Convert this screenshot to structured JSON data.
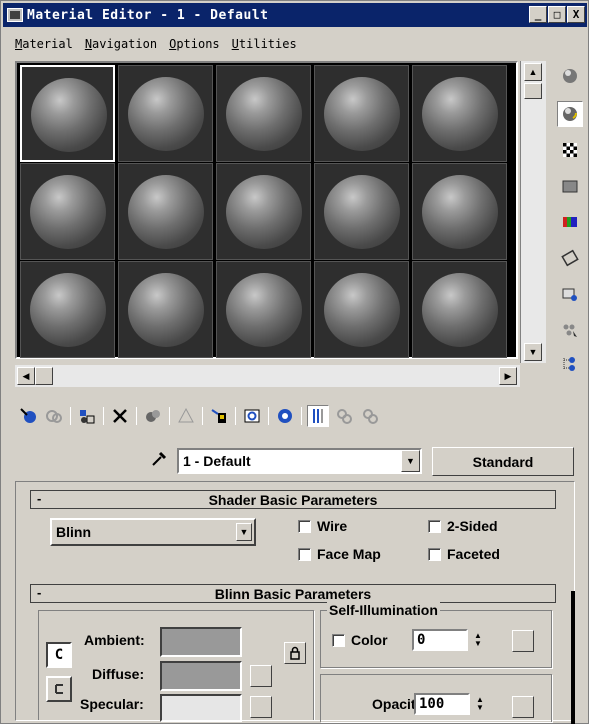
{
  "window": {
    "title": "Material Editor - 1 - Default",
    "buttons": [
      "_",
      "□",
      "X"
    ]
  },
  "menu": [
    {
      "label": "Material",
      "underline": "M"
    },
    {
      "label": "Navigation",
      "underline": "N"
    },
    {
      "label": "Options",
      "underline": "O"
    },
    {
      "label": "Utilities",
      "underline": "U"
    }
  ],
  "samples": {
    "rows": 3,
    "cols": 5,
    "selected_index": 0
  },
  "right_toolbar": [
    {
      "icon": "sample-type-sphere-icon"
    },
    {
      "icon": "backlight-icon",
      "active": true
    },
    {
      "icon": "background-checker-icon"
    },
    {
      "icon": "sample-uv-tiling-icon"
    },
    {
      "icon": "video-color-check-icon"
    },
    {
      "icon": "make-preview-icon"
    },
    {
      "icon": "options-icon"
    },
    {
      "icon": "select-by-material-icon"
    },
    {
      "icon": "material-map-navigator-icon"
    }
  ],
  "bottom_toolbar": [
    "get-material-icon",
    "put-to-scene-icon",
    "assign-to-selection-icon",
    "reset-map-icon",
    "make-unique-icon",
    "put-to-library-icon",
    "material-effects-channel-icon",
    "show-map-in-viewport-icon",
    "show-end-result-icon",
    "go-to-parent-icon",
    "go-forward-to-sibling-icon"
  ],
  "name_row": {
    "material_name": "1 - Default",
    "type_button": "Standard"
  },
  "shader_rollout": {
    "title": "Shader Basic Parameters",
    "minus": "-",
    "shader": "Blinn",
    "wire": "Wire",
    "two_sided": "2-Sided",
    "face_map": "Face Map",
    "faceted": "Faceted"
  },
  "blinn_rollout": {
    "title": "Blinn Basic Parameters",
    "minus": "-",
    "ambient": "Ambient:",
    "diffuse": "Diffuse:",
    "specular": "Specular:",
    "self_illum_title": "Self-Illumination",
    "color_label": "Color",
    "color_value": "0",
    "opacity_label": "Opacity:",
    "opacity_value": "100",
    "c_label": "C"
  },
  "colors": {
    "titlebar": "#0a246a",
    "swatch": "#999999",
    "specular_swatch": "#e6e6e6"
  }
}
